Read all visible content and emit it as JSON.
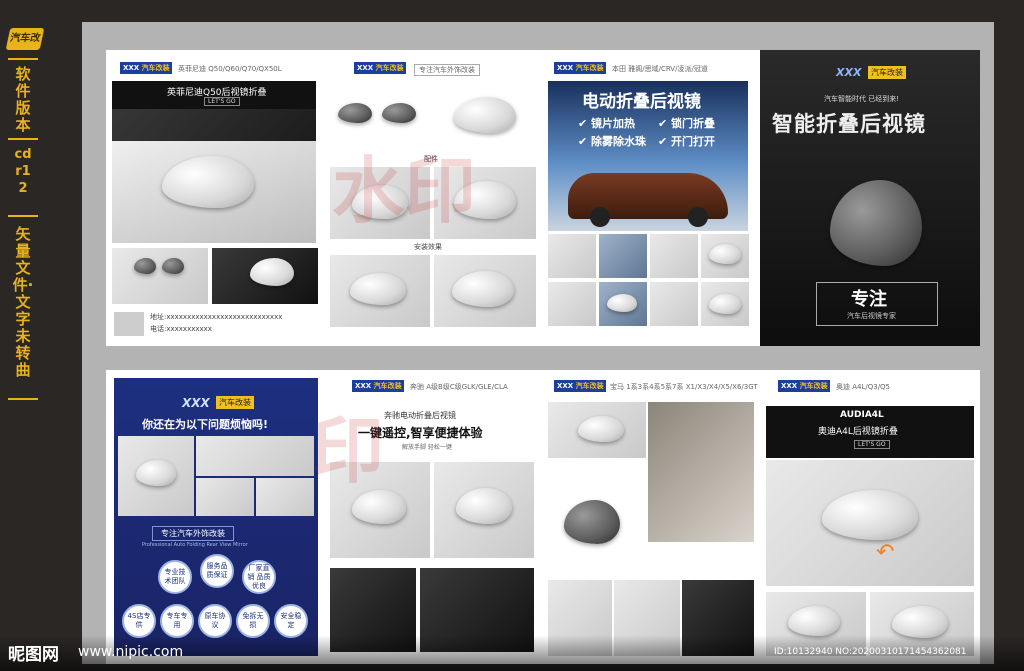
{
  "sidebar": {
    "logo_text": "汽车改装",
    "label_software": "软件版本",
    "label_version": "cdr12",
    "label_files": "矢量文件·文字未转曲"
  },
  "board1": {
    "page1": {
      "models": "英菲尼迪 Q50/Q60/Q70/QX50L",
      "title": "英菲尼迪Q50后视镜折叠",
      "subtitle": "LET'S GO",
      "address_label": "地址:",
      "address_value": "xxxxxxxxxxxxxxxxxxxxxxxxxxxx",
      "phone_label": "电话:",
      "phone_value": "xxxxxxxxxxx"
    },
    "page2": {
      "tagline": "专注汽车外饰改装",
      "caption1": "配件",
      "caption2": "安装效果"
    },
    "page3": {
      "models": "本田 雅阁/思域/CRV/凌派/冠道",
      "headline": "电动折叠后视镜",
      "features": [
        "镜片加热",
        "锁门折叠",
        "除雾除水珠",
        "开门打开"
      ]
    },
    "page4": {
      "brand": "XXX",
      "brand_tag": "汽车改装",
      "slogan": "汽车智能时代 已经到来!",
      "headline": "智能折叠后视镜",
      "focus": "专注",
      "focus_sub": "汽车后视镜专家"
    }
  },
  "board2": {
    "page1": {
      "brand": "XXX",
      "brand_tag": "汽车改装",
      "question": "你还在为以下问题烦恼吗!",
      "ribbon": "专注汽车外饰改装",
      "ribbon_en": "Professional Auto Folding Rear View Mirror",
      "bubbles_top": [
        "专业技术团队",
        "服务品质保证",
        "厂家直销 品质优良"
      ],
      "bubbles_bottom": [
        "4S店专供",
        "专车专用",
        "原车协议",
        "免拆无损",
        "安全稳定"
      ]
    },
    "page2": {
      "models": "奔驰 A级B级C级GLK/GLE/CLA",
      "title": "奔驰电动折叠后视镜",
      "headline": "一键遥控,智享便捷体验",
      "sub": "解放手脚 轻松一键"
    },
    "page3": {
      "models": "宝马 1系3系4系5系7系 X1/X3/X4/X5/X6/3GT"
    },
    "page4": {
      "models": "奥迪 A4L/Q3/Q5",
      "model_name": "AUDIA4L",
      "title": "奥迪A4L后视镜折叠",
      "subtitle": "LET'S GO"
    }
  },
  "watermark": {
    "id_text": "ID:10132940 NO:20200310171454362081",
    "site_logo": "昵图网",
    "site_url": "www.nipic.com"
  },
  "colors": {
    "background": "#2b2725",
    "accent_yellow": "#e8b21d",
    "brand_blue": "#1c3e9c",
    "workspace_grey": "#b3b3b3"
  }
}
